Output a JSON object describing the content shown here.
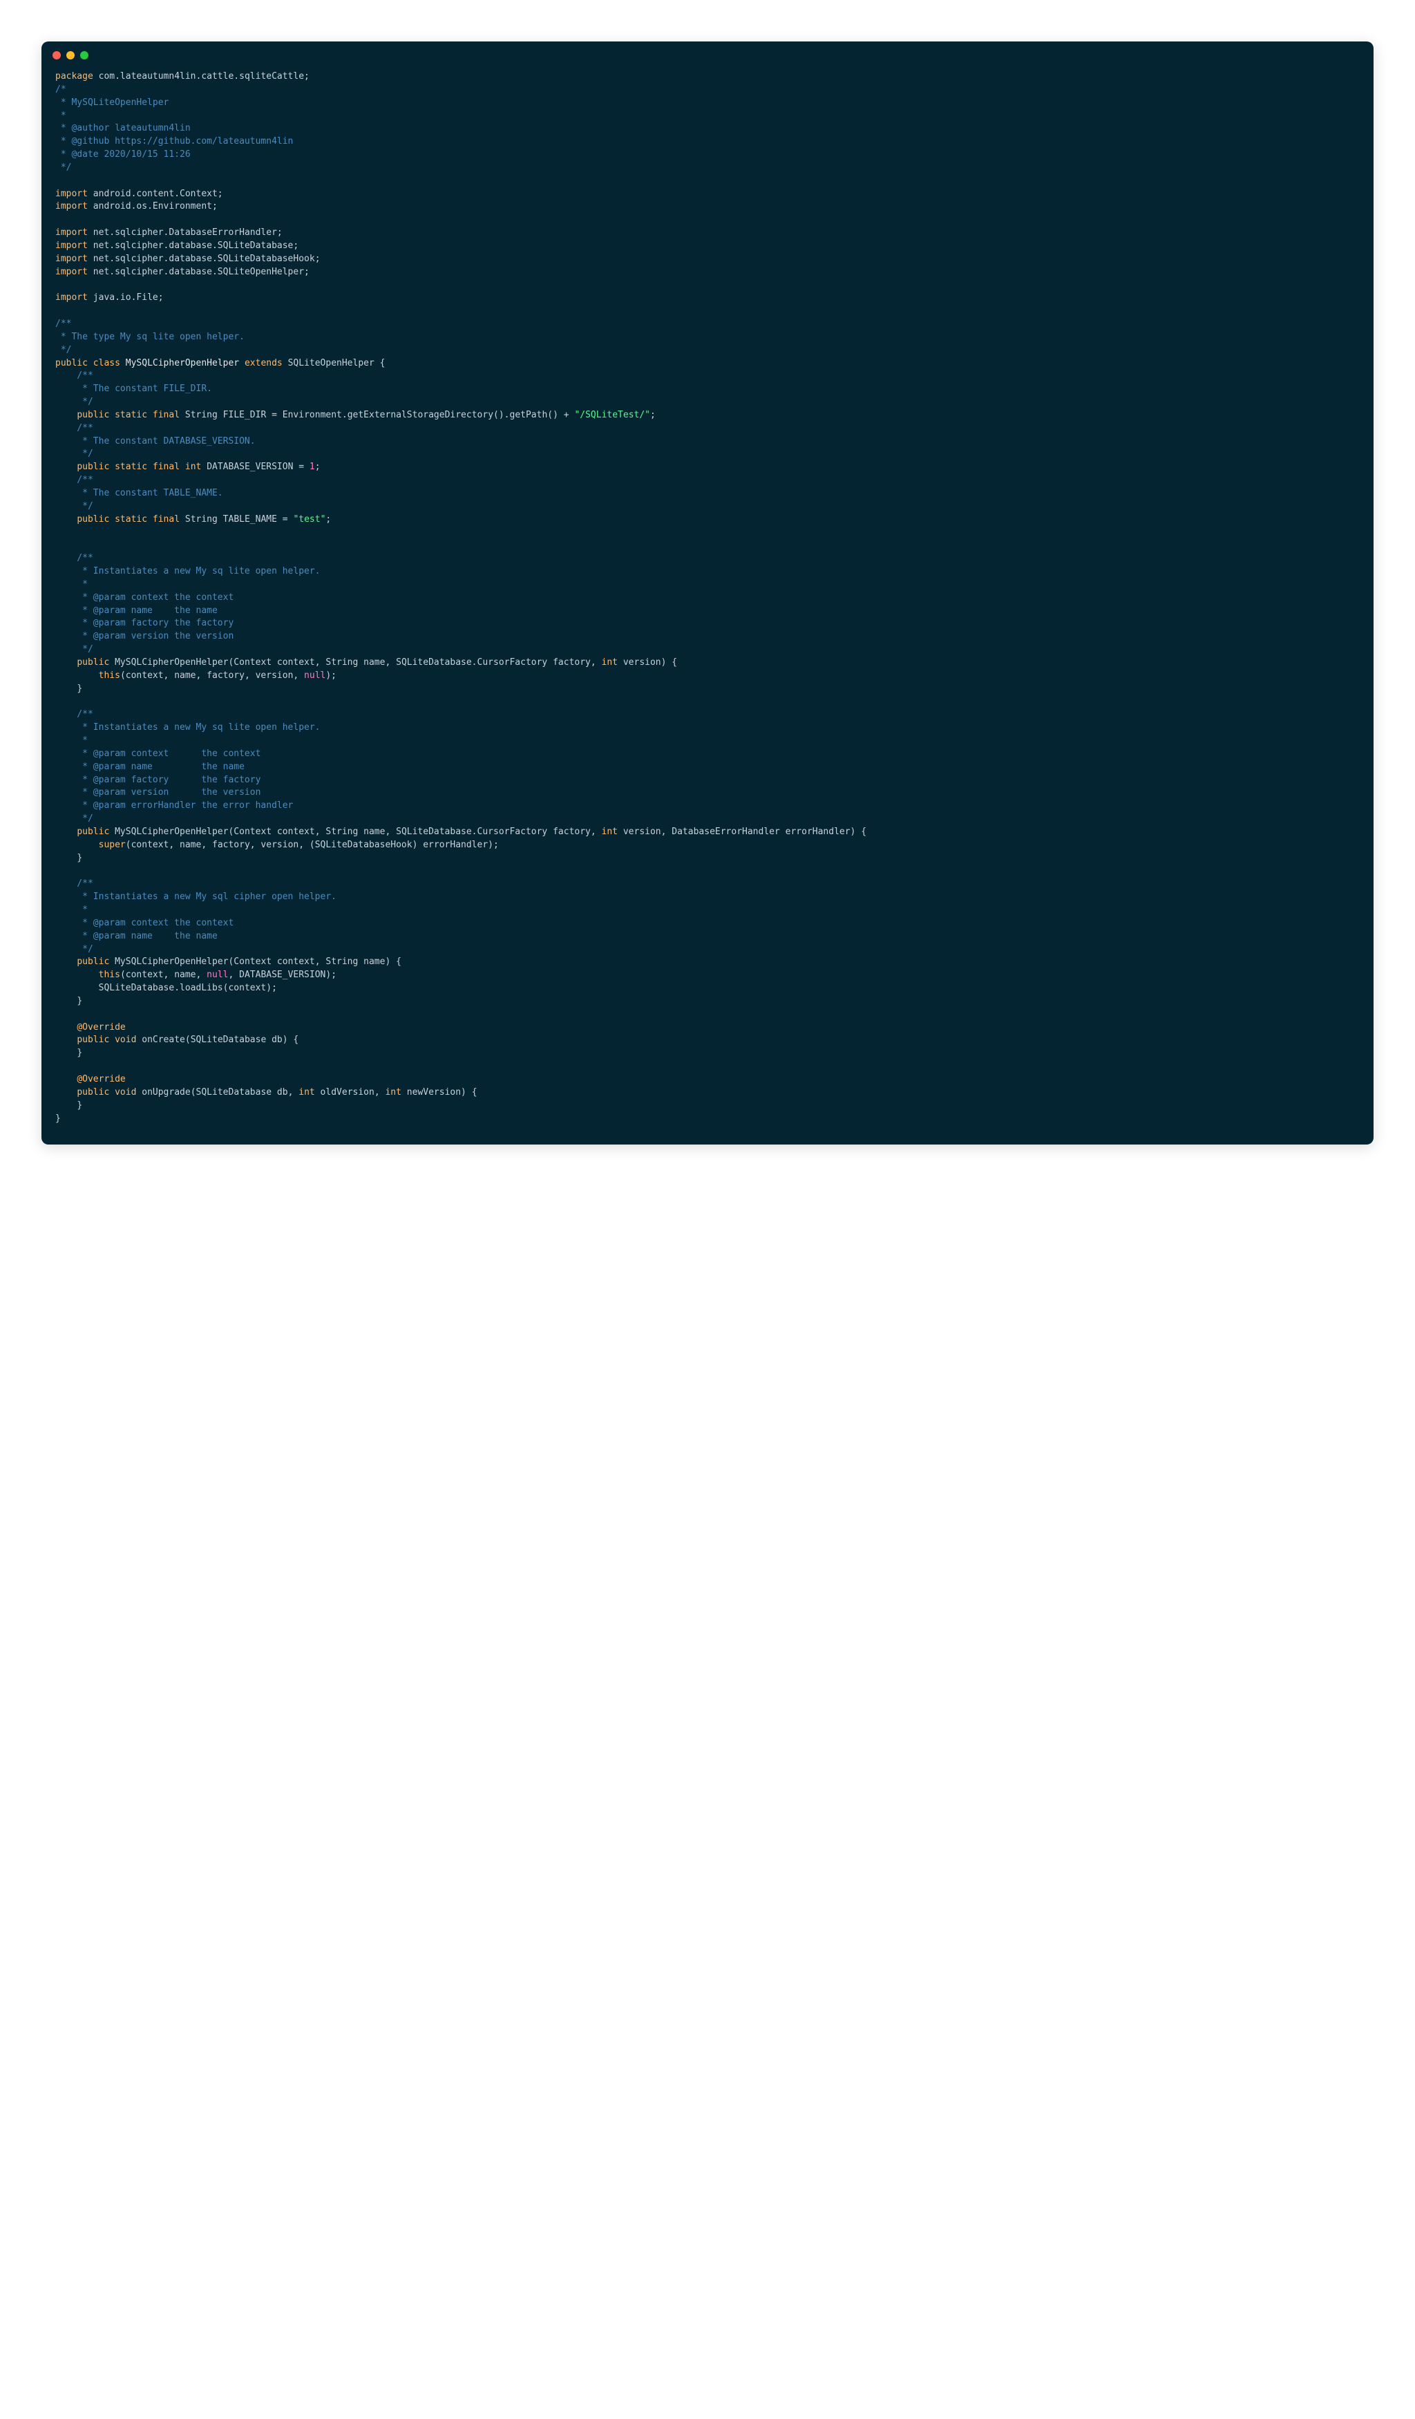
{
  "colors": {
    "bg": "#042432",
    "keyword": "#ffb86c",
    "comment": "#4c8bbd",
    "string": "#5af78e",
    "number": "#ff79c6",
    "default": "#c9d1d9"
  },
  "code": {
    "package_kw": "package",
    "package_name": "com.lateautumn4lin.cattle.sqliteCattle;",
    "header_comment_open": "/*",
    "header_comment_l1": " * MySQLiteOpenHelper",
    "header_comment_l2": " *",
    "header_comment_l3": " * @author lateautumn4lin",
    "header_comment_l4": " * @github https://github.com/lateautumn4lin",
    "header_comment_l5": " * @date 2020/10/15 11:26",
    "header_comment_close": " */",
    "import_kw": "import",
    "import1": "android.content.Context;",
    "import2": "android.os.Environment;",
    "import3": "net.sqlcipher.DatabaseErrorHandler;",
    "import4": "net.sqlcipher.database.SQLiteDatabase;",
    "import5": "net.sqlcipher.database.SQLiteDatabaseHook;",
    "import6": "net.sqlcipher.database.SQLiteOpenHelper;",
    "import7": "java.io.File;",
    "class_doc_open": "/**",
    "class_doc_l1": " * The type My sq lite open helper.",
    "class_doc_close": " */",
    "public_kw": "public",
    "class_kw": "class",
    "class_name": "MySQLCipherOpenHelper",
    "extends_kw": "extends",
    "super_name": "SQLiteOpenHelper",
    "brace_open": "{",
    "brace_close": "}",
    "filedir_doc_open": "    /**",
    "filedir_doc_l1": "     * The constant FILE_DIR.",
    "filedir_doc_close": "     */",
    "static_kw": "static",
    "final_kw": "final",
    "string_type": "String",
    "filedir_name": "FILE_DIR",
    "eq": "=",
    "filedir_expr": "Environment.getExternalStorageDirectory().getPath() +",
    "filedir_str": "\"/SQLiteTest/\"",
    "semicolon": ";",
    "dbver_doc_open": "    /**",
    "dbver_doc_l1": "     * The constant DATABASE_VERSION.",
    "dbver_doc_close": "     */",
    "int_type": "int",
    "dbver_name": "DATABASE_VERSION",
    "dbver_val": "1",
    "tblname_doc_open": "    /**",
    "tblname_doc_l1": "     * The constant TABLE_NAME.",
    "tblname_doc_close": "     */",
    "tblname_name": "TABLE_NAME",
    "tblname_val": "\"test\"",
    "ctor1_doc_open": "    /**",
    "ctor1_doc_l1": "     * Instantiates a new My sq lite open helper.",
    "ctor1_doc_l2": "     *",
    "ctor1_doc_l3": "     * @param context the context",
    "ctor1_doc_l4": "     * @param name    the name",
    "ctor1_doc_l5": "     * @param factory the factory",
    "ctor1_doc_l6": "     * @param version the version",
    "ctor1_doc_close": "     */",
    "ctor_name": "MySQLCipherOpenHelper",
    "ctor1_params": "(Context context, String name, SQLiteDatabase.CursorFactory factory, ",
    "ctor1_params2": "int",
    "ctor1_params3": " version) {",
    "ctor1_body_this": "this",
    "ctor1_body_rest": "(context, name, factory, version, ",
    "null_kw": "null",
    "ctor1_body_end": ");",
    "ctor2_doc_open": "    /**",
    "ctor2_doc_l1": "     * Instantiates a new My sq lite open helper.",
    "ctor2_doc_l2": "     *",
    "ctor2_doc_l3": "     * @param context      the context",
    "ctor2_doc_l4": "     * @param name         the name",
    "ctor2_doc_l5": "     * @param factory      the factory",
    "ctor2_doc_l6": "     * @param version      the version",
    "ctor2_doc_l7": "     * @param errorHandler the error handler",
    "ctor2_doc_close": "     */",
    "ctor2_params": "(Context context, String name, SQLiteDatabase.CursorFactory factory, ",
    "ctor2_params2": "int",
    "ctor2_params3": " version, DatabaseErrorHandler errorHandler) {",
    "ctor2_body_super": "super",
    "ctor2_body_rest": "(context, name, factory, version, (SQLiteDatabaseHook) errorHandler);",
    "ctor3_doc_open": "    /**",
    "ctor3_doc_l1": "     * Instantiates a new My sql cipher open helper.",
    "ctor3_doc_l2": "     *",
    "ctor3_doc_l3": "     * @param context the context",
    "ctor3_doc_l4": "     * @param name    the name",
    "ctor3_doc_close": "     */",
    "ctor3_params": "(Context context, String name) {",
    "ctor3_body_this": "this",
    "ctor3_body_rest": "(context, name, ",
    "ctor3_body_end": ", DATABASE_VERSION);",
    "ctor3_body_line2": "SQLiteDatabase.loadLibs(context);",
    "override_ann": "@Override",
    "void_kw": "void",
    "oncreate_name": "onCreate",
    "oncreate_params": "(SQLiteDatabase db) {",
    "onupgrade_name": "onUpgrade",
    "onupgrade_params_a": "(SQLiteDatabase db, ",
    "onupgrade_params_b": " oldVersion, ",
    "onupgrade_params_c": " newVersion) {"
  }
}
